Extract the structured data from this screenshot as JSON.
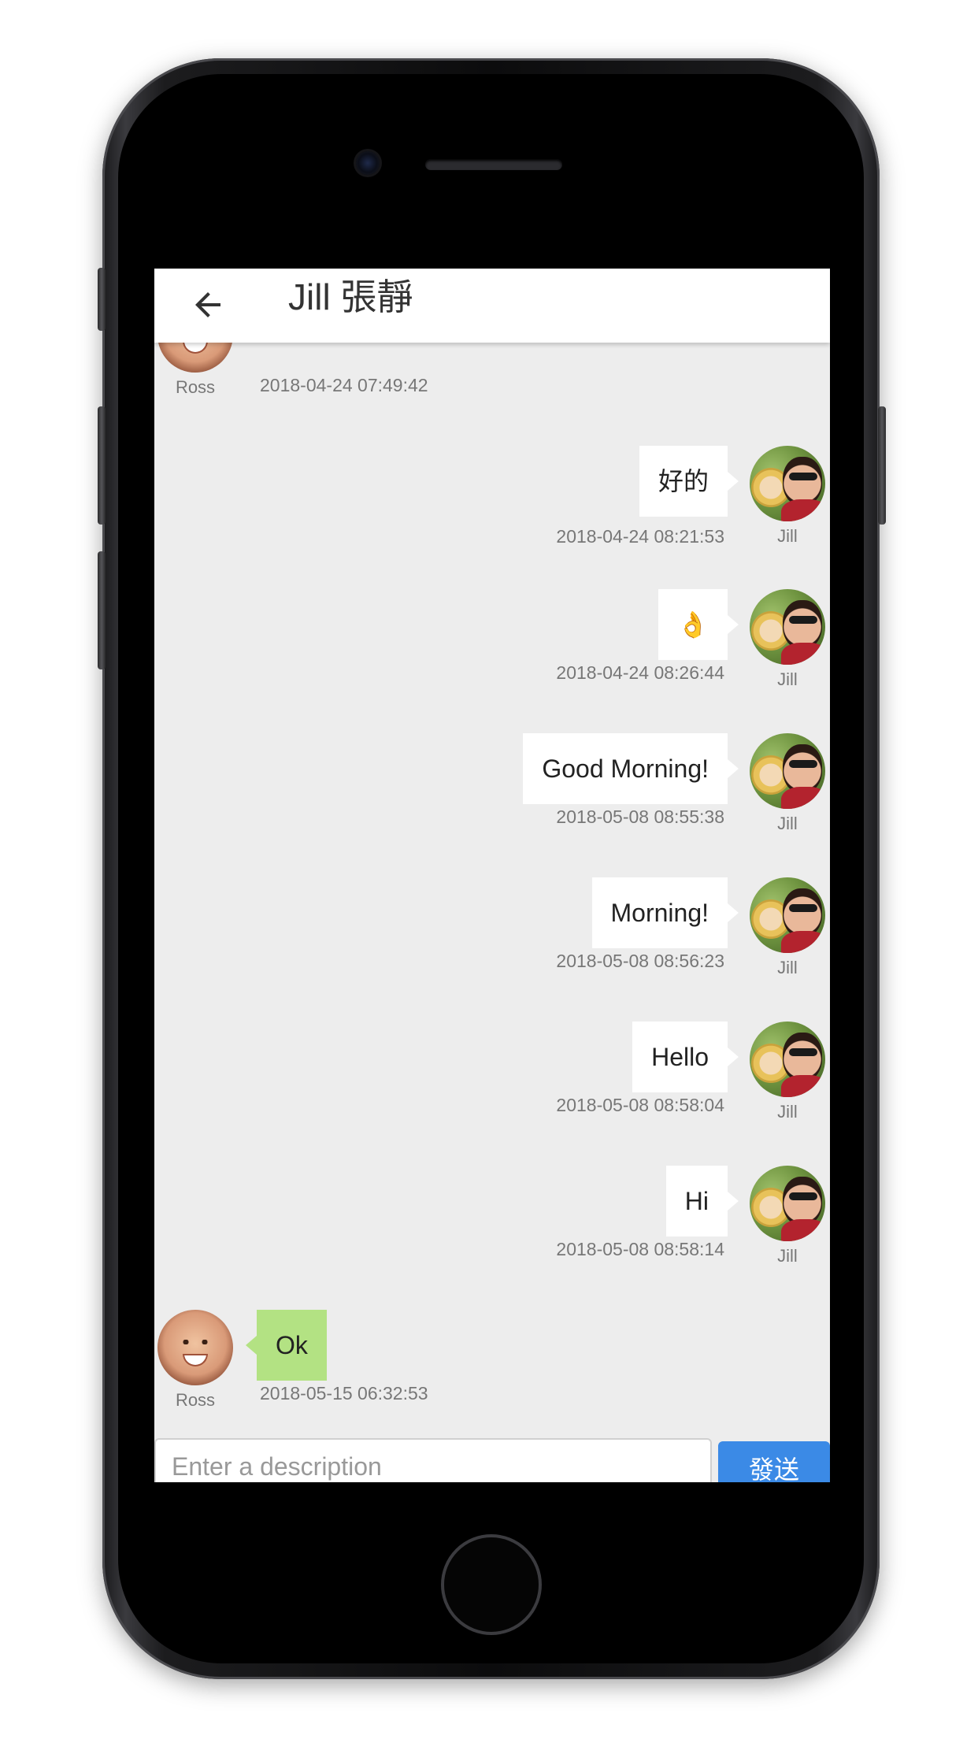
{
  "header": {
    "title": "Jill 張靜",
    "back_icon": "arrow-left-icon"
  },
  "messages": [
    {
      "sender": "Ross",
      "side": "them",
      "text": "",
      "timestamp": "2018-04-24 07:49:42"
    },
    {
      "sender": "Jill",
      "side": "me",
      "text": "好的",
      "timestamp": "2018-04-24 08:21:53"
    },
    {
      "sender": "Jill",
      "side": "me",
      "text": "👌",
      "timestamp": "2018-04-24 08:26:44"
    },
    {
      "sender": "Jill",
      "side": "me",
      "text": "Good Morning!",
      "timestamp": "2018-05-08 08:55:38"
    },
    {
      "sender": "Jill",
      "side": "me",
      "text": "Morning!",
      "timestamp": "2018-05-08 08:56:23"
    },
    {
      "sender": "Jill",
      "side": "me",
      "text": "Hello",
      "timestamp": "2018-05-08 08:58:04"
    },
    {
      "sender": "Jill",
      "side": "me",
      "text": "Hi",
      "timestamp": "2018-05-08 08:58:14"
    },
    {
      "sender": "Ross",
      "side": "them",
      "text": "Ok",
      "timestamp": "2018-05-15 06:32:53"
    }
  ],
  "composer": {
    "placeholder": "Enter a description",
    "value": "",
    "send_label": "發送"
  },
  "colors": {
    "background": "#ededed",
    "my_bubble": "#ffffff",
    "their_bubble": "#b3e283",
    "send_button": "#3b8ae6"
  }
}
